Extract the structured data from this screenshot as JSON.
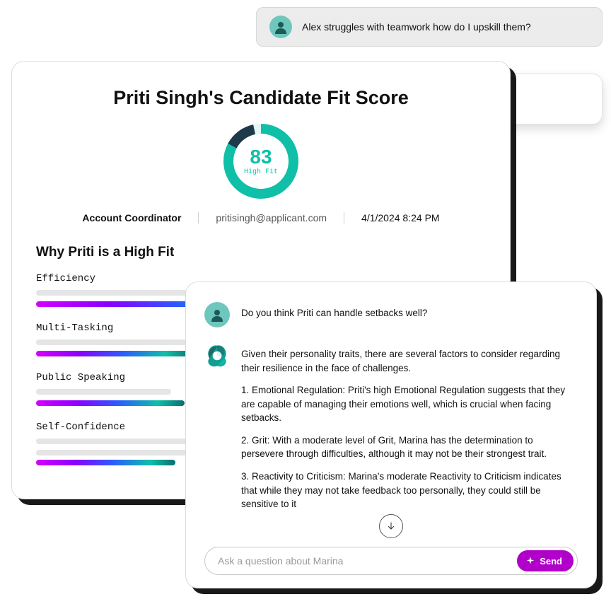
{
  "top_chat": {
    "message": "Alex struggles with teamwork how do I upskill them?"
  },
  "scorecard": {
    "title": "Priti Singh's Candidate Fit Score",
    "score": "83",
    "score_label": "High Fit",
    "role": "Account Coordinator",
    "email": "pritisingh@applicant.com",
    "timestamp": "4/1/2024  8:24 PM",
    "why_heading": "Why Priti is a High Fit",
    "skills": [
      "Efficiency",
      "Multi-Tasking",
      "Public Speaking",
      "Self-Confidence"
    ]
  },
  "chat": {
    "user_question": "Do you think Priti can handle setbacks well?",
    "ai_intro": "Given their personality traits, there are several factors to consider regarding their resilience in the face of challenges.",
    "ai_p1": "1. Emotional Regulation: Priti's high Emotional Regulation suggests that they are capable of managing their emotions well, which is crucial when facing setbacks.",
    "ai_p2": "2. Grit: With a moderate level of Grit, Marina has the determination to persevere through difficulties, although it may not be their strongest trait.",
    "ai_p3": "3. Reactivity to Criticism: Marina's moderate Reactivity to Criticism indicates that while they may not take feedback too personally, they could still be sensitive to it",
    "input_placeholder": "Ask a question about Marina",
    "send_label": "Send"
  },
  "chart_data": {
    "type": "bar",
    "title": "Candidate Fit Score",
    "score": 83,
    "score_max": 100,
    "score_label": "High Fit",
    "categories": [
      "Efficiency",
      "Multi-Tasking",
      "Public Speaking",
      "Self-Confidence"
    ],
    "values": [
      58,
      35,
      33,
      31
    ]
  }
}
